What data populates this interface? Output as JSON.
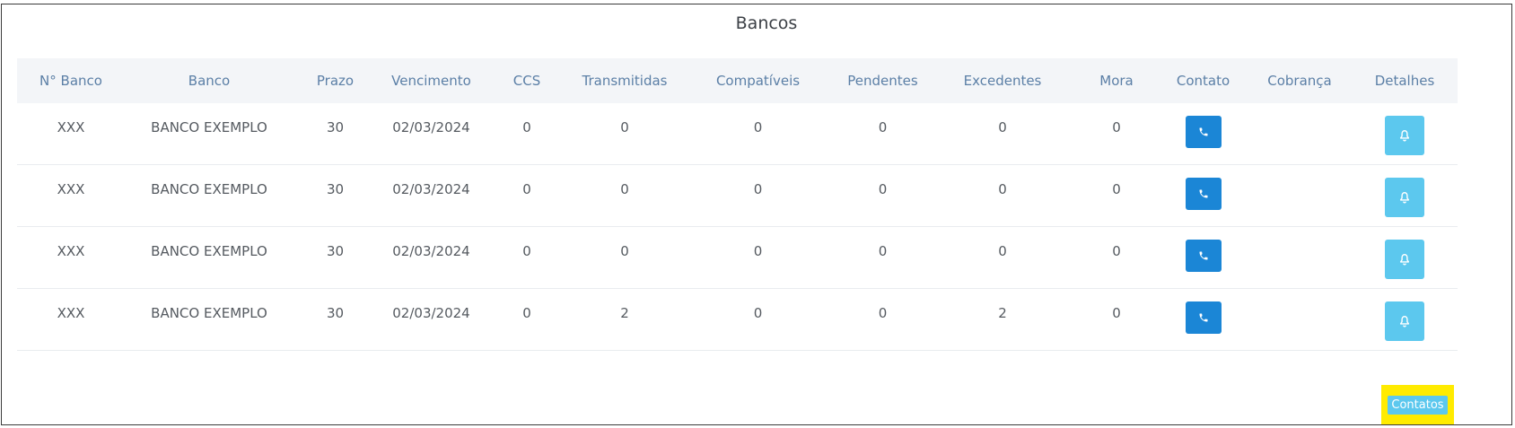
{
  "page": {
    "title": "Bancos"
  },
  "table": {
    "headers": [
      "N° Banco",
      "Banco",
      "Prazo",
      "Vencimento",
      "CCS",
      "Transmitidas",
      "Compatíveis",
      "Pendentes",
      "Excedentes",
      "Mora",
      "Contato",
      "Cobrança",
      "Detalhes"
    ],
    "rows": [
      {
        "numero": "XXX",
        "banco": "BANCO EXEMPLO",
        "prazo": "30",
        "vencimento": "02/03/2024",
        "ccs": "0",
        "transmitidas": "0",
        "compativeis": "0",
        "pendentes": "0",
        "excedentes": "0",
        "mora": "0",
        "cobranca": ""
      },
      {
        "numero": "XXX",
        "banco": "BANCO EXEMPLO",
        "prazo": "30",
        "vencimento": "02/03/2024",
        "ccs": "0",
        "transmitidas": "0",
        "compativeis": "0",
        "pendentes": "0",
        "excedentes": "0",
        "mora": "0",
        "cobranca": ""
      },
      {
        "numero": "XXX",
        "banco": "BANCO EXEMPLO",
        "prazo": "30",
        "vencimento": "02/03/2024",
        "ccs": "0",
        "transmitidas": "0",
        "compativeis": "0",
        "pendentes": "0",
        "excedentes": "0",
        "mora": "0",
        "cobranca": ""
      },
      {
        "numero": "XXX",
        "banco": "BANCO EXEMPLO",
        "prazo": "30",
        "vencimento": "02/03/2024",
        "ccs": "0",
        "transmitidas": "2",
        "compativeis": "0",
        "pendentes": "0",
        "excedentes": "2",
        "mora": "0",
        "cobranca": ""
      }
    ],
    "contact_icon": "phone-icon",
    "detail_icon": "bell-icon"
  },
  "footer": {
    "contatos_label": "Contatos"
  },
  "colors": {
    "header_text": "#5b7fa6",
    "phone_button": "#1b86d6",
    "detail_button": "#5cc8ee",
    "highlight": "#ffeb00"
  }
}
